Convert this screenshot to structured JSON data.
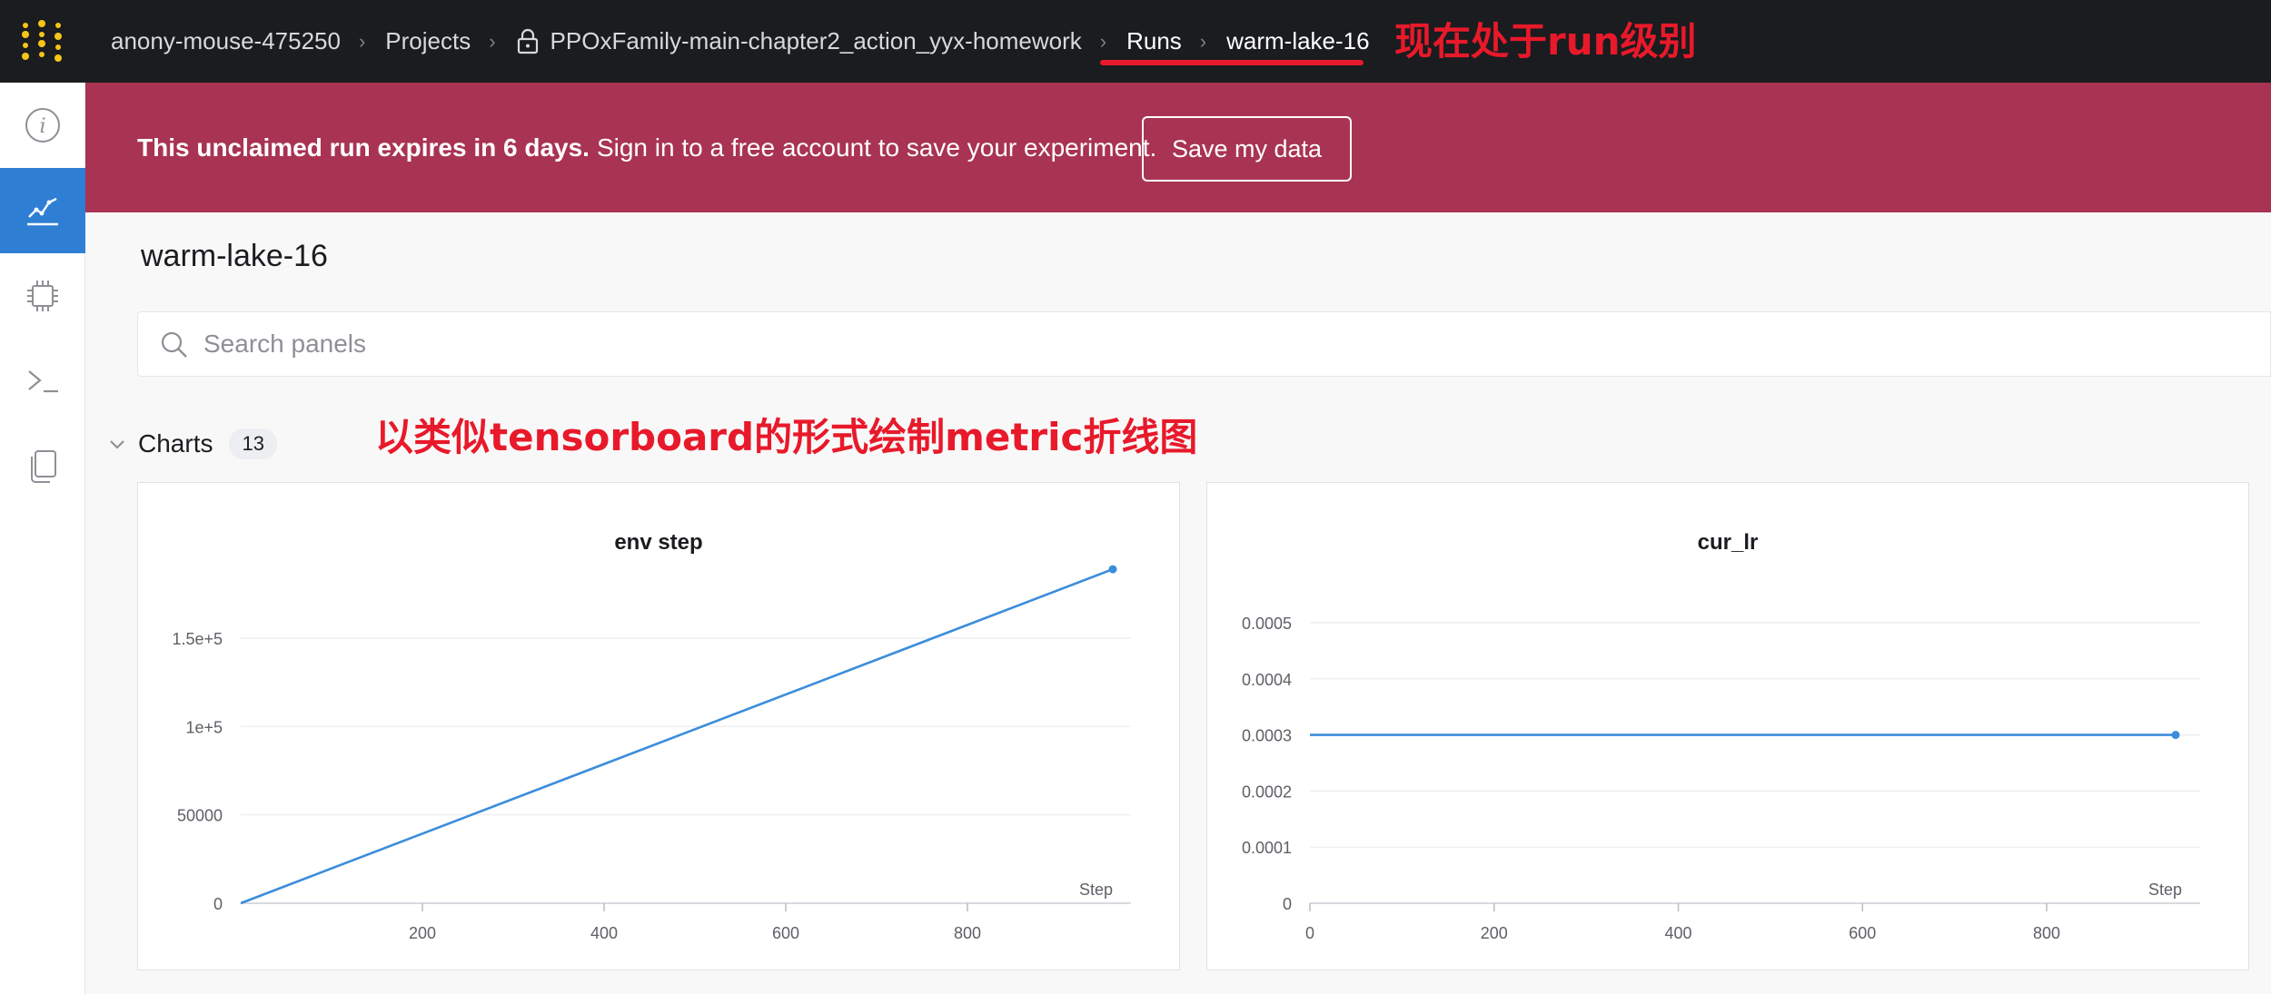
{
  "topbar": {
    "breadcrumbs": {
      "user": "anony-mouse-475250",
      "projects": "Projects",
      "project": "PPOxFamily-main-chapter2_action_yyx-homework",
      "runs": "Runs",
      "run": "warm-lake-16"
    },
    "separator": "›",
    "annotation": "现在处于run级别",
    "annotation_color": "#e8192a"
  },
  "rail": {
    "items": [
      {
        "icon": "info-icon",
        "active": false
      },
      {
        "icon": "line-chart-icon",
        "active": true
      },
      {
        "icon": "cpu-chip-icon",
        "active": false
      },
      {
        "icon": "terminal-icon",
        "active": false
      },
      {
        "icon": "files-icon",
        "active": false
      }
    ],
    "active_color": "#2e7fd4"
  },
  "banner": {
    "bold_text": "This unclaimed run expires in 6 days.",
    "text": "Sign in to a free account to save your experiment.",
    "button_label": "Save my data",
    "background": "#a93352"
  },
  "main": {
    "run_title": "warm-lake-16",
    "search_placeholder": "Search panels",
    "section_label": "Charts",
    "section_count": "13",
    "annotation": "以类似tensorboard的形式绘制metric折线图"
  },
  "chart_data": [
    {
      "type": "line",
      "title": "env step",
      "xlabel": "Step",
      "ylabel": "",
      "xlim": [
        0,
        960
      ],
      "ylim": [
        0,
        190000
      ],
      "x_ticks": [
        200,
        400,
        600,
        800
      ],
      "x_tick_labels": [
        "200",
        "400",
        "600",
        "800"
      ],
      "y_ticks": [
        0,
        50000,
        100000,
        150000
      ],
      "y_tick_labels": [
        "0",
        "50000",
        "1e+5",
        "1.5e+5"
      ],
      "grid": true,
      "line_color": "#3b8ddb",
      "series": [
        {
          "x": [
            0,
            960
          ],
          "y": [
            0,
            189000
          ],
          "end_marker": true
        }
      ]
    },
    {
      "type": "line",
      "title": "cur_lr",
      "xlabel": "Step",
      "ylabel": "",
      "xlim": [
        0,
        940
      ],
      "ylim": [
        0,
        0.0005
      ],
      "x_ticks": [
        0,
        200,
        400,
        600,
        800
      ],
      "x_tick_labels": [
        "0",
        "200",
        "400",
        "600",
        "800"
      ],
      "y_ticks": [
        0,
        0.0001,
        0.0002,
        0.0003,
        0.0004,
        0.0005
      ],
      "y_tick_labels": [
        "0",
        "0.0001",
        "0.0002",
        "0.0003",
        "0.0004",
        "0.0005"
      ],
      "grid": true,
      "line_color": "#3b8ddb",
      "series": [
        {
          "x": [
            0,
            940
          ],
          "y": [
            0.0003,
            0.0003
          ],
          "end_marker": true
        }
      ]
    }
  ]
}
